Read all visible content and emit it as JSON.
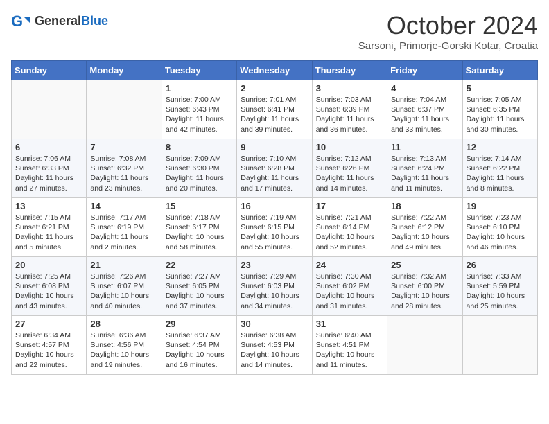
{
  "header": {
    "logo_general": "General",
    "logo_blue": "Blue",
    "month_title": "October 2024",
    "subtitle": "Sarsoni, Primorje-Gorski Kotar, Croatia"
  },
  "columns": [
    "Sunday",
    "Monday",
    "Tuesday",
    "Wednesday",
    "Thursday",
    "Friday",
    "Saturday"
  ],
  "weeks": [
    [
      {
        "day": "",
        "info": ""
      },
      {
        "day": "",
        "info": ""
      },
      {
        "day": "1",
        "info": "Sunrise: 7:00 AM\nSunset: 6:43 PM\nDaylight: 11 hours and 42 minutes."
      },
      {
        "day": "2",
        "info": "Sunrise: 7:01 AM\nSunset: 6:41 PM\nDaylight: 11 hours and 39 minutes."
      },
      {
        "day": "3",
        "info": "Sunrise: 7:03 AM\nSunset: 6:39 PM\nDaylight: 11 hours and 36 minutes."
      },
      {
        "day": "4",
        "info": "Sunrise: 7:04 AM\nSunset: 6:37 PM\nDaylight: 11 hours and 33 minutes."
      },
      {
        "day": "5",
        "info": "Sunrise: 7:05 AM\nSunset: 6:35 PM\nDaylight: 11 hours and 30 minutes."
      }
    ],
    [
      {
        "day": "6",
        "info": "Sunrise: 7:06 AM\nSunset: 6:33 PM\nDaylight: 11 hours and 27 minutes."
      },
      {
        "day": "7",
        "info": "Sunrise: 7:08 AM\nSunset: 6:32 PM\nDaylight: 11 hours and 23 minutes."
      },
      {
        "day": "8",
        "info": "Sunrise: 7:09 AM\nSunset: 6:30 PM\nDaylight: 11 hours and 20 minutes."
      },
      {
        "day": "9",
        "info": "Sunrise: 7:10 AM\nSunset: 6:28 PM\nDaylight: 11 hours and 17 minutes."
      },
      {
        "day": "10",
        "info": "Sunrise: 7:12 AM\nSunset: 6:26 PM\nDaylight: 11 hours and 14 minutes."
      },
      {
        "day": "11",
        "info": "Sunrise: 7:13 AM\nSunset: 6:24 PM\nDaylight: 11 hours and 11 minutes."
      },
      {
        "day": "12",
        "info": "Sunrise: 7:14 AM\nSunset: 6:22 PM\nDaylight: 11 hours and 8 minutes."
      }
    ],
    [
      {
        "day": "13",
        "info": "Sunrise: 7:15 AM\nSunset: 6:21 PM\nDaylight: 11 hours and 5 minutes."
      },
      {
        "day": "14",
        "info": "Sunrise: 7:17 AM\nSunset: 6:19 PM\nDaylight: 11 hours and 2 minutes."
      },
      {
        "day": "15",
        "info": "Sunrise: 7:18 AM\nSunset: 6:17 PM\nDaylight: 10 hours and 58 minutes."
      },
      {
        "day": "16",
        "info": "Sunrise: 7:19 AM\nSunset: 6:15 PM\nDaylight: 10 hours and 55 minutes."
      },
      {
        "day": "17",
        "info": "Sunrise: 7:21 AM\nSunset: 6:14 PM\nDaylight: 10 hours and 52 minutes."
      },
      {
        "day": "18",
        "info": "Sunrise: 7:22 AM\nSunset: 6:12 PM\nDaylight: 10 hours and 49 minutes."
      },
      {
        "day": "19",
        "info": "Sunrise: 7:23 AM\nSunset: 6:10 PM\nDaylight: 10 hours and 46 minutes."
      }
    ],
    [
      {
        "day": "20",
        "info": "Sunrise: 7:25 AM\nSunset: 6:08 PM\nDaylight: 10 hours and 43 minutes."
      },
      {
        "day": "21",
        "info": "Sunrise: 7:26 AM\nSunset: 6:07 PM\nDaylight: 10 hours and 40 minutes."
      },
      {
        "day": "22",
        "info": "Sunrise: 7:27 AM\nSunset: 6:05 PM\nDaylight: 10 hours and 37 minutes."
      },
      {
        "day": "23",
        "info": "Sunrise: 7:29 AM\nSunset: 6:03 PM\nDaylight: 10 hours and 34 minutes."
      },
      {
        "day": "24",
        "info": "Sunrise: 7:30 AM\nSunset: 6:02 PM\nDaylight: 10 hours and 31 minutes."
      },
      {
        "day": "25",
        "info": "Sunrise: 7:32 AM\nSunset: 6:00 PM\nDaylight: 10 hours and 28 minutes."
      },
      {
        "day": "26",
        "info": "Sunrise: 7:33 AM\nSunset: 5:59 PM\nDaylight: 10 hours and 25 minutes."
      }
    ],
    [
      {
        "day": "27",
        "info": "Sunrise: 6:34 AM\nSunset: 4:57 PM\nDaylight: 10 hours and 22 minutes."
      },
      {
        "day": "28",
        "info": "Sunrise: 6:36 AM\nSunset: 4:56 PM\nDaylight: 10 hours and 19 minutes."
      },
      {
        "day": "29",
        "info": "Sunrise: 6:37 AM\nSunset: 4:54 PM\nDaylight: 10 hours and 16 minutes."
      },
      {
        "day": "30",
        "info": "Sunrise: 6:38 AM\nSunset: 4:53 PM\nDaylight: 10 hours and 14 minutes."
      },
      {
        "day": "31",
        "info": "Sunrise: 6:40 AM\nSunset: 4:51 PM\nDaylight: 10 hours and 11 minutes."
      },
      {
        "day": "",
        "info": ""
      },
      {
        "day": "",
        "info": ""
      }
    ]
  ]
}
